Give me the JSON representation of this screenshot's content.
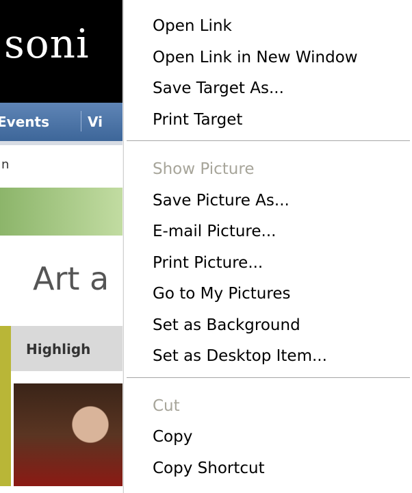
{
  "page": {
    "logo_text": "soni",
    "nav": [
      "Events",
      "Vi"
    ],
    "breadcrumb": "n",
    "heading": "Art a",
    "tab_label": "Highligh"
  },
  "context_menu": {
    "groups": [
      {
        "items": [
          {
            "label": "Open Link",
            "enabled": true
          },
          {
            "label": "Open Link in New Window",
            "enabled": true
          },
          {
            "label": "Save Target As...",
            "enabled": true
          },
          {
            "label": "Print Target",
            "enabled": true
          }
        ]
      },
      {
        "items": [
          {
            "label": "Show Picture",
            "enabled": false
          },
          {
            "label": "Save Picture As...",
            "enabled": true
          },
          {
            "label": "E-mail Picture...",
            "enabled": true
          },
          {
            "label": "Print Picture...",
            "enabled": true
          },
          {
            "label": "Go to My Pictures",
            "enabled": true
          },
          {
            "label": "Set as Background",
            "enabled": true
          },
          {
            "label": "Set as Desktop Item...",
            "enabled": true
          }
        ]
      },
      {
        "items": [
          {
            "label": "Cut",
            "enabled": false
          },
          {
            "label": "Copy",
            "enabled": true
          },
          {
            "label": "Copy Shortcut",
            "enabled": true
          }
        ]
      }
    ]
  },
  "colors": {
    "menu_disabled_text": "#a7a59a",
    "nav_bar": "#4a72a6",
    "banner": "#000000"
  }
}
